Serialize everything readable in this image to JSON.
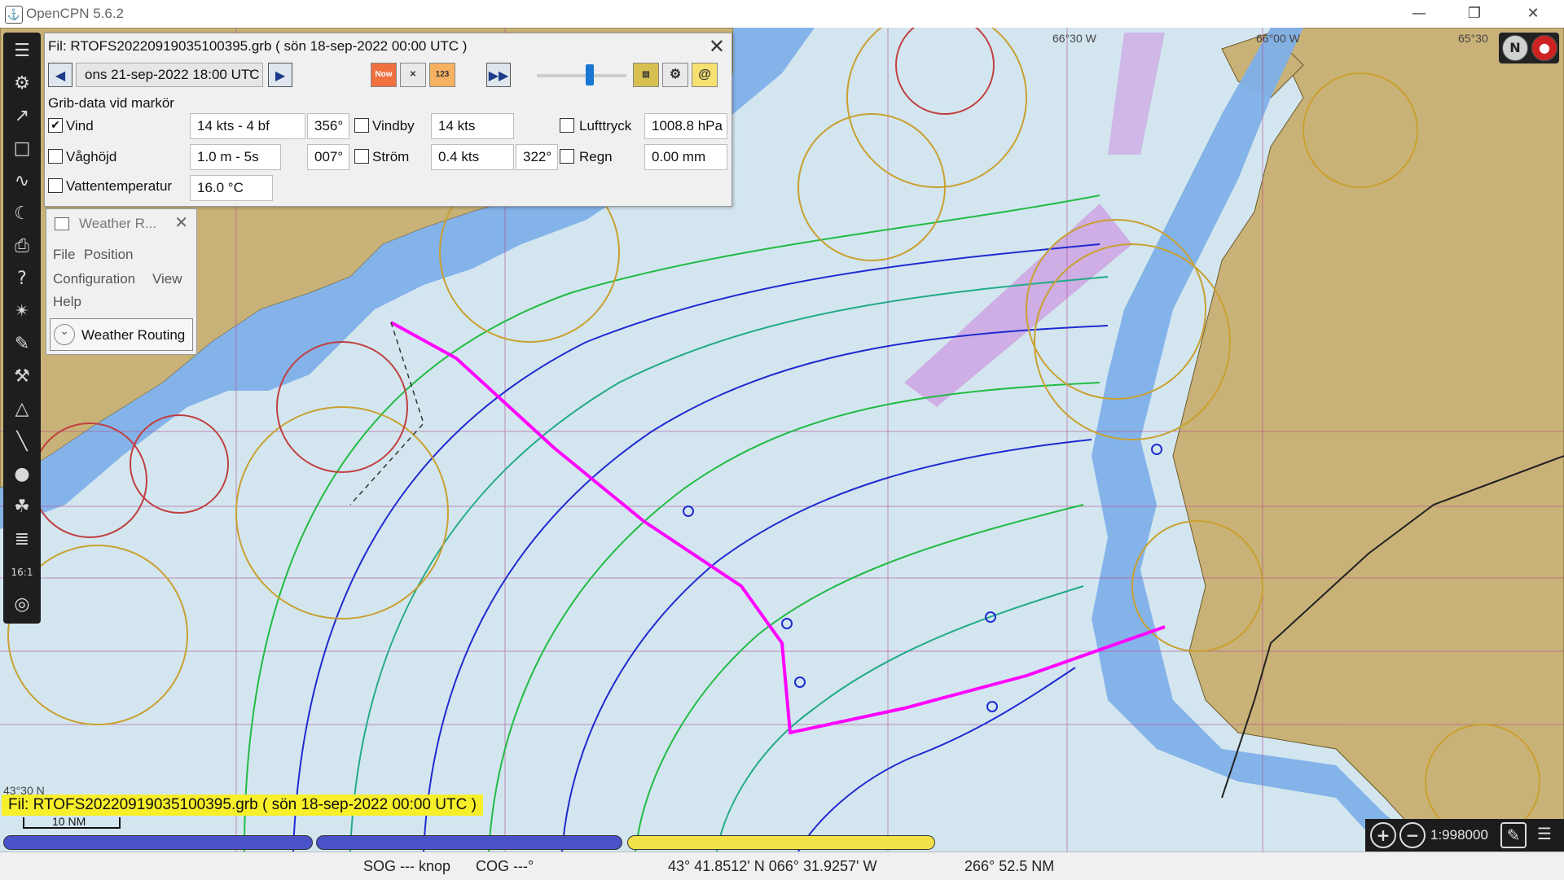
{
  "window": {
    "title": "OpenCPN 5.6.2",
    "app_icon_glyph": "⚓",
    "minimize": "—",
    "maximize": "❐",
    "close": "✕"
  },
  "chart_labels": {
    "lon1": "66°30 W",
    "lon2": "66°00 W",
    "lon3": "65°30",
    "lat1": "43°30 N"
  },
  "grib": {
    "title": "Fil: RTOFS20220919035100395.grb ( sön 18-sep-2022 00:00  UTC )",
    "close": "✕",
    "prev_glyph": "◀",
    "next_glyph": "▶",
    "play_glyph": "▶▶",
    "time": "ons 21-sep-2022 18:00  UTC",
    "time_caret": "⌄",
    "now_label": "Now",
    "counter_label": "123",
    "at_label": "@",
    "cursor_header": "Grib-data vid markör",
    "wind_label": "Vind",
    "wind_checked": "✔",
    "wind_value": "14 kts -  4 bf",
    "wind_dir": "356°",
    "gust_label": "Vindby",
    "gust_value": "14 kts",
    "pressure_label": "Lufttryck",
    "pressure_value": "1008.8 hPa",
    "wave_label": "Våghöjd",
    "wave_value": "1.0 m - 5s",
    "wave_dir": "007°",
    "current_label": "Ström",
    "current_value": "0.4 kts",
    "current_dir": "322°",
    "rain_label": "Regn",
    "rain_value": "0.00 mm",
    "temp_label": "Vattentemperatur",
    "temp_value": "16.0 °C"
  },
  "weather_routing": {
    "title": "Weather R...",
    "close": "✕",
    "menu_file": "File",
    "menu_position": "Position",
    "menu_configuration": "Configuration",
    "menu_view": "View",
    "menu_help": "Help",
    "button_label": "Weather Routing",
    "button_chevron": "⌄"
  },
  "banner": {
    "file_text": "Fil: RTOFS20220919035100395.grb ( sön 18-sep-2022 00:00  UTC )",
    "scale_label": "10 NM"
  },
  "zoom": {
    "zoom_in": "+",
    "zoom_out": "−",
    "scale": "1:998000",
    "menu_glyph": "☰"
  },
  "status": {
    "sog": "SOG --- knop",
    "cog": "COG ---°",
    "position": "43° 41.8512' N   066° 31.9257' W",
    "bearing": "266°   52.5 NM"
  },
  "toolbar_glyphs": [
    "☰",
    "⚙",
    "↗",
    "□",
    "∿",
    "☾",
    "⎙",
    "?",
    "✴",
    "✎",
    "⚒",
    "△",
    "╲",
    "●",
    "☘",
    "≣",
    "16:1",
    "◎"
  ],
  "colors": {
    "land": "#c9b277",
    "shallow": "#7fb0e8",
    "deep": "#d3e6f0",
    "route": "#ff00ff",
    "isochrone_green": "#22bb44",
    "isochrone_blue": "#1f2bd0",
    "file_banner": "#f7ef2a"
  }
}
